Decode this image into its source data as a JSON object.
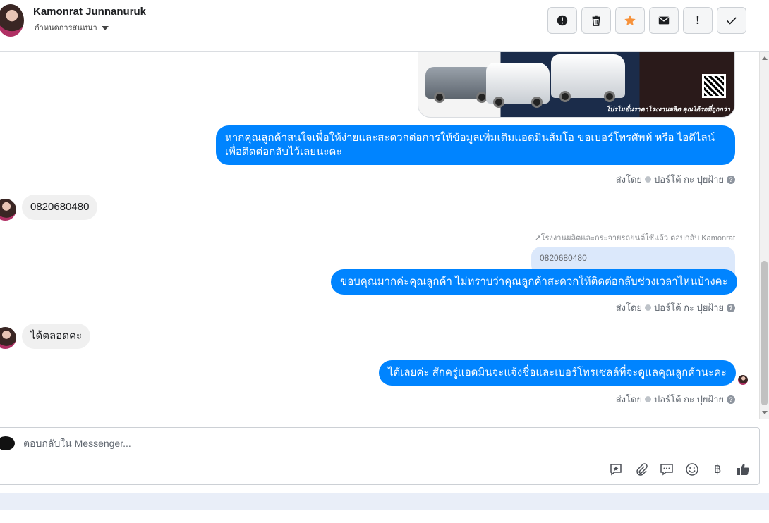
{
  "header": {
    "contact_name": "Kamonrat Junnanuruk",
    "conversation_status": "กำหนดการสนทนา",
    "toolbar": [
      {
        "icon": "alert-circle-icon",
        "label": ""
      },
      {
        "icon": "trash-icon",
        "label": ""
      },
      {
        "icon": "star-icon",
        "label": ""
      },
      {
        "icon": "envelope-icon",
        "label": ""
      },
      {
        "icon": "exclamation-icon",
        "label": "!"
      },
      {
        "icon": "checkmark-icon",
        "label": ""
      }
    ]
  },
  "ad_image": {
    "caption": "โปรโมชั่นราคาโรงงานผลิต คุณได้รถที่ถูกกว่า"
  },
  "messages": [
    {
      "direction": "out",
      "text": "หากคุณลูกค้าสนใจเพื่อให้ง่ายและสะดวกต่อการให้ข้อมูลเพิ่มเติมแอดมินส้มโอ ขอเบอร์โทรศัพท์ หรือ ไอดีไลน์ เพื่อติดต่อกลับไว้เลยนะคะ"
    },
    {
      "direction": "in",
      "text": "0820680480"
    },
    {
      "direction": "out",
      "text": "ขอบคุณมากค่ะคุณลูกค้า ไม่ทราบว่าคุณลูกค้าสะดวกให้ติดต่อกลับช่วงเวลาไหนบ้างคะ",
      "reply_note": "โรงงานผลิตและกระจายรถยนต์ใช้แล้ว ตอบกลับ Kamonrat",
      "quoted": "0820680480"
    },
    {
      "direction": "in",
      "text": "ได้ตลอดคะ"
    },
    {
      "direction": "out",
      "text": "ได้เลยค่ะ สักครู่แอดมินจะแจ้งชื่อและเบอร์โทรเซลล์ที่จะดูแลคุณลูกค้านะคะ"
    }
  ],
  "sent_by": {
    "prefix": "ส่งโดย",
    "name": "ปอร์โต้ กะ ปุยฝ้าย"
  },
  "composer": {
    "placeholder": "ตอบกลับใน Messenger...",
    "icons": [
      "saved-reply-icon",
      "attachment-icon",
      "chat-bubble-icon",
      "emoji-icon",
      "baht-icon",
      "thumbs-up-icon"
    ],
    "baht_symbol": "฿"
  },
  "colors": {
    "outgoing_bubble": "#0084ff",
    "incoming_bubble": "#f0f0f0",
    "star": "#f7923b"
  }
}
